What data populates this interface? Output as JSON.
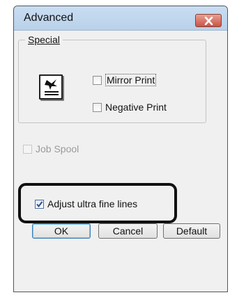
{
  "window": {
    "title": "Advanced"
  },
  "special": {
    "group_label": "Special",
    "mirror_print": {
      "label": "Mirror Print",
      "checked": false
    },
    "negative_print": {
      "label": "Negative Print",
      "checked": false
    }
  },
  "job_spool": {
    "label": "Job Spool",
    "checked": false,
    "enabled": false
  },
  "adjust_fine_lines": {
    "label": "Adjust ultra fine lines",
    "checked": true
  },
  "buttons": {
    "ok": "OK",
    "cancel": "Cancel",
    "default": "Default"
  },
  "colors": {
    "title_bar": "#b9d1ea",
    "close_button": "#c95446",
    "dialog_bg": "#f0f0f0",
    "highlight": "#111111"
  },
  "icons": {
    "close": "close-icon",
    "printer": "printer-document-icon"
  }
}
